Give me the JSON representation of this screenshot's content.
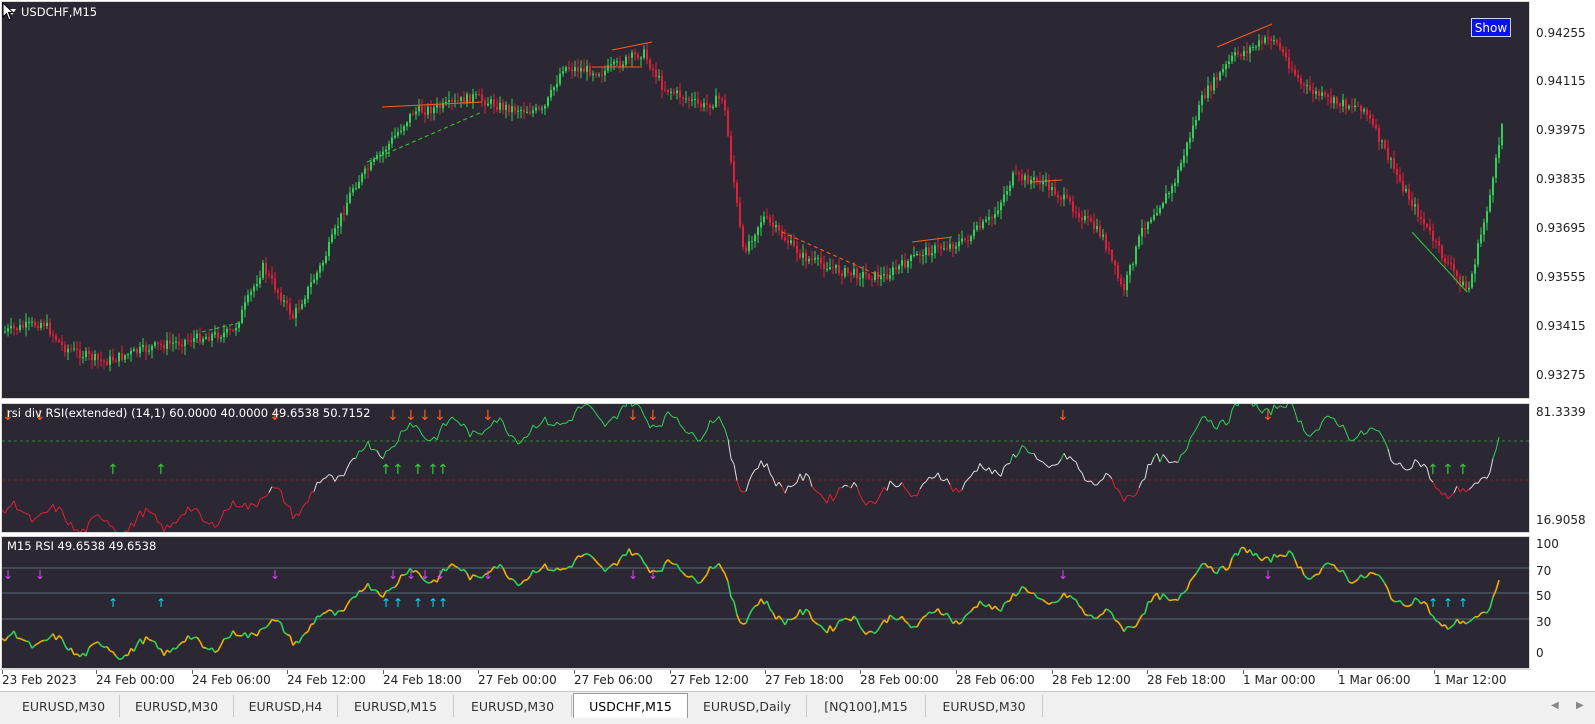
{
  "main": {
    "symbol": "USDCHF,M15",
    "show_button": "Show",
    "price_labels": [
      "0.94255",
      "0.94115",
      "0.93975",
      "0.93835",
      "0.93695",
      "0.93555",
      "0.93415",
      "0.93275"
    ]
  },
  "rsi_div": {
    "label": "rsi div RSI(extended) (14,1) 60.0000 40.0000 49.6538 50.7152",
    "scale_max": "81.3339",
    "scale_min": "16.9058"
  },
  "rsi_m15": {
    "label": "M15 RSI 49.6538 49.6538",
    "levels": [
      "100",
      "70",
      "50",
      "30",
      "0"
    ]
  },
  "time_axis": {
    "labels": [
      "23 Feb 2023",
      "24 Feb 00:00",
      "24 Feb 06:00",
      "24 Feb 12:00",
      "24 Feb 18:00",
      "27 Feb 00:00",
      "27 Feb 06:00",
      "27 Feb 12:00",
      "27 Feb 18:00",
      "28 Feb 00:00",
      "28 Feb 06:00",
      "28 Feb 12:00",
      "28 Feb 18:00",
      "1 Mar 00:00",
      "1 Mar 06:00",
      "1 Mar 12:00"
    ]
  },
  "tabs": [
    {
      "label": "EURUSD,M30"
    },
    {
      "label": "EURUSD,M30"
    },
    {
      "label": "EURUSD,H4"
    },
    {
      "label": "EURUSD,M15"
    },
    {
      "label": "EURUSD,M30"
    },
    {
      "label": "USDCHF,M15",
      "active": true
    },
    {
      "label": "EURUSD,Daily"
    },
    {
      "label": "[NQ100],M15"
    },
    {
      "label": "EURUSD,M30"
    }
  ],
  "colors": {
    "background": "#2b2833",
    "bull": "#2fd158",
    "bear": "#e0203a",
    "bear_divergence": "#ff5a1f",
    "bull_divergence": "#33cc33",
    "rsi_line": "#f0b000",
    "arrow_down": "#e040fb",
    "arrow_up": "#00e5ff"
  }
}
